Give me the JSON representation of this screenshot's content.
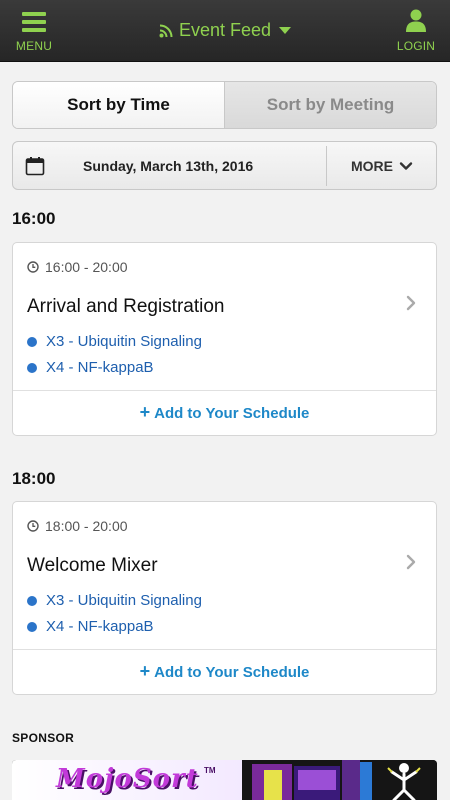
{
  "header": {
    "menu_label": "MENU",
    "title": "Event Feed",
    "login_label": "LOGIN",
    "accent_color": "#8fd14f"
  },
  "sort": {
    "by_time": "Sort by Time",
    "by_meeting": "Sort by Meeting",
    "active": "by_time"
  },
  "date_bar": {
    "date": "Sunday, March 13th, 2016",
    "more_label": "MORE"
  },
  "groups": [
    {
      "heading": "16:00",
      "event": {
        "time_range": "16:00 - 20:00",
        "title": "Arrival and Registration",
        "tracks": [
          "X3 - Ubiquitin Signaling",
          "X4 - NF-kappaB"
        ],
        "add_label": "Add to Your Schedule"
      }
    },
    {
      "heading": "18:00",
      "event": {
        "time_range": "18:00 - 20:00",
        "title": "Welcome Mixer",
        "tracks": [
          "X3 - Ubiquitin Signaling",
          "X4 - NF-kappaB"
        ],
        "add_label": "Add to Your Schedule"
      }
    }
  ],
  "sponsor": {
    "label": "SPONSOR",
    "banner_text": "MojoSort",
    "trademark": "TM"
  },
  "icons": {
    "menu": "hamburger-icon",
    "feed": "rss-icon",
    "login": "person-icon",
    "calendar": "calendar-icon",
    "more": "chevron-down-icon",
    "time": "clock-icon",
    "open": "chevron-right-icon",
    "add": "plus-icon"
  }
}
